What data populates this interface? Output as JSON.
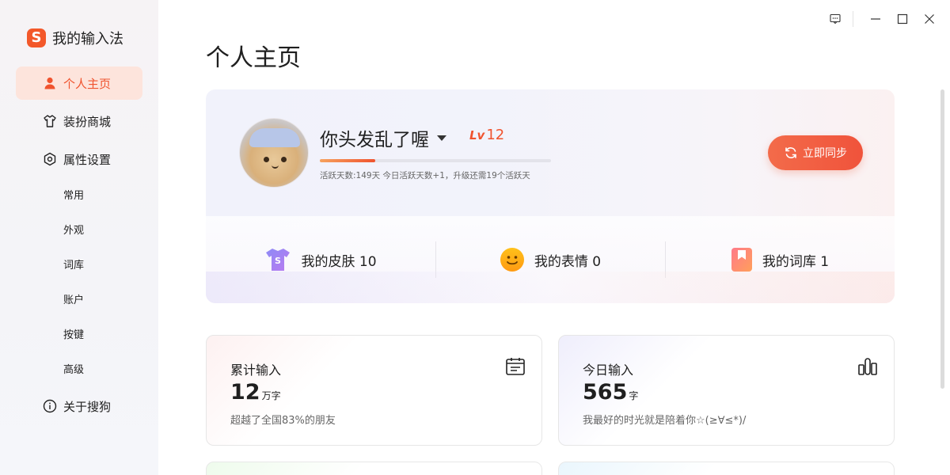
{
  "app": {
    "title": "我的输入法",
    "logo_letter": "S",
    "accent": "#f0532e"
  },
  "sidebar": {
    "items": [
      {
        "label": "个人主页",
        "icon": "user-icon",
        "active": true
      },
      {
        "label": "装扮商城",
        "icon": "tshirt-icon",
        "active": false
      },
      {
        "label": "属性设置",
        "icon": "settings-icon",
        "active": false
      },
      {
        "label": "关于搜狗",
        "icon": "info-icon",
        "active": false
      }
    ],
    "sub_items": [
      "常用",
      "外观",
      "词库",
      "账户",
      "按键",
      "高级"
    ]
  },
  "page": {
    "title": "个人主页"
  },
  "profile": {
    "username": "你头发乱了喔",
    "level_prefix": "Lv",
    "level": "12",
    "progress_fraction": 0.24,
    "progress_text": "活跃天数:149天 今日活跃天数+1，升级还需19个活跃天",
    "sync_label": "立即同步"
  },
  "stats": [
    {
      "label": "我的皮肤 10",
      "icon": "skin-icon"
    },
    {
      "label": "我的表情 0",
      "icon": "emoji-icon"
    },
    {
      "label": "我的词库 1",
      "icon": "dictionary-icon"
    }
  ],
  "cards": {
    "total": {
      "title": "累计输入",
      "value": "12",
      "unit": "万字",
      "note": "超越了全国83%的朋友",
      "icon": "calendar-icon"
    },
    "today": {
      "title": "今日输入",
      "value": "565",
      "unit": "字",
      "note": "我最好的时光就是陪着你☆(≥∀≤*)/",
      "icon": "like-icon"
    }
  }
}
